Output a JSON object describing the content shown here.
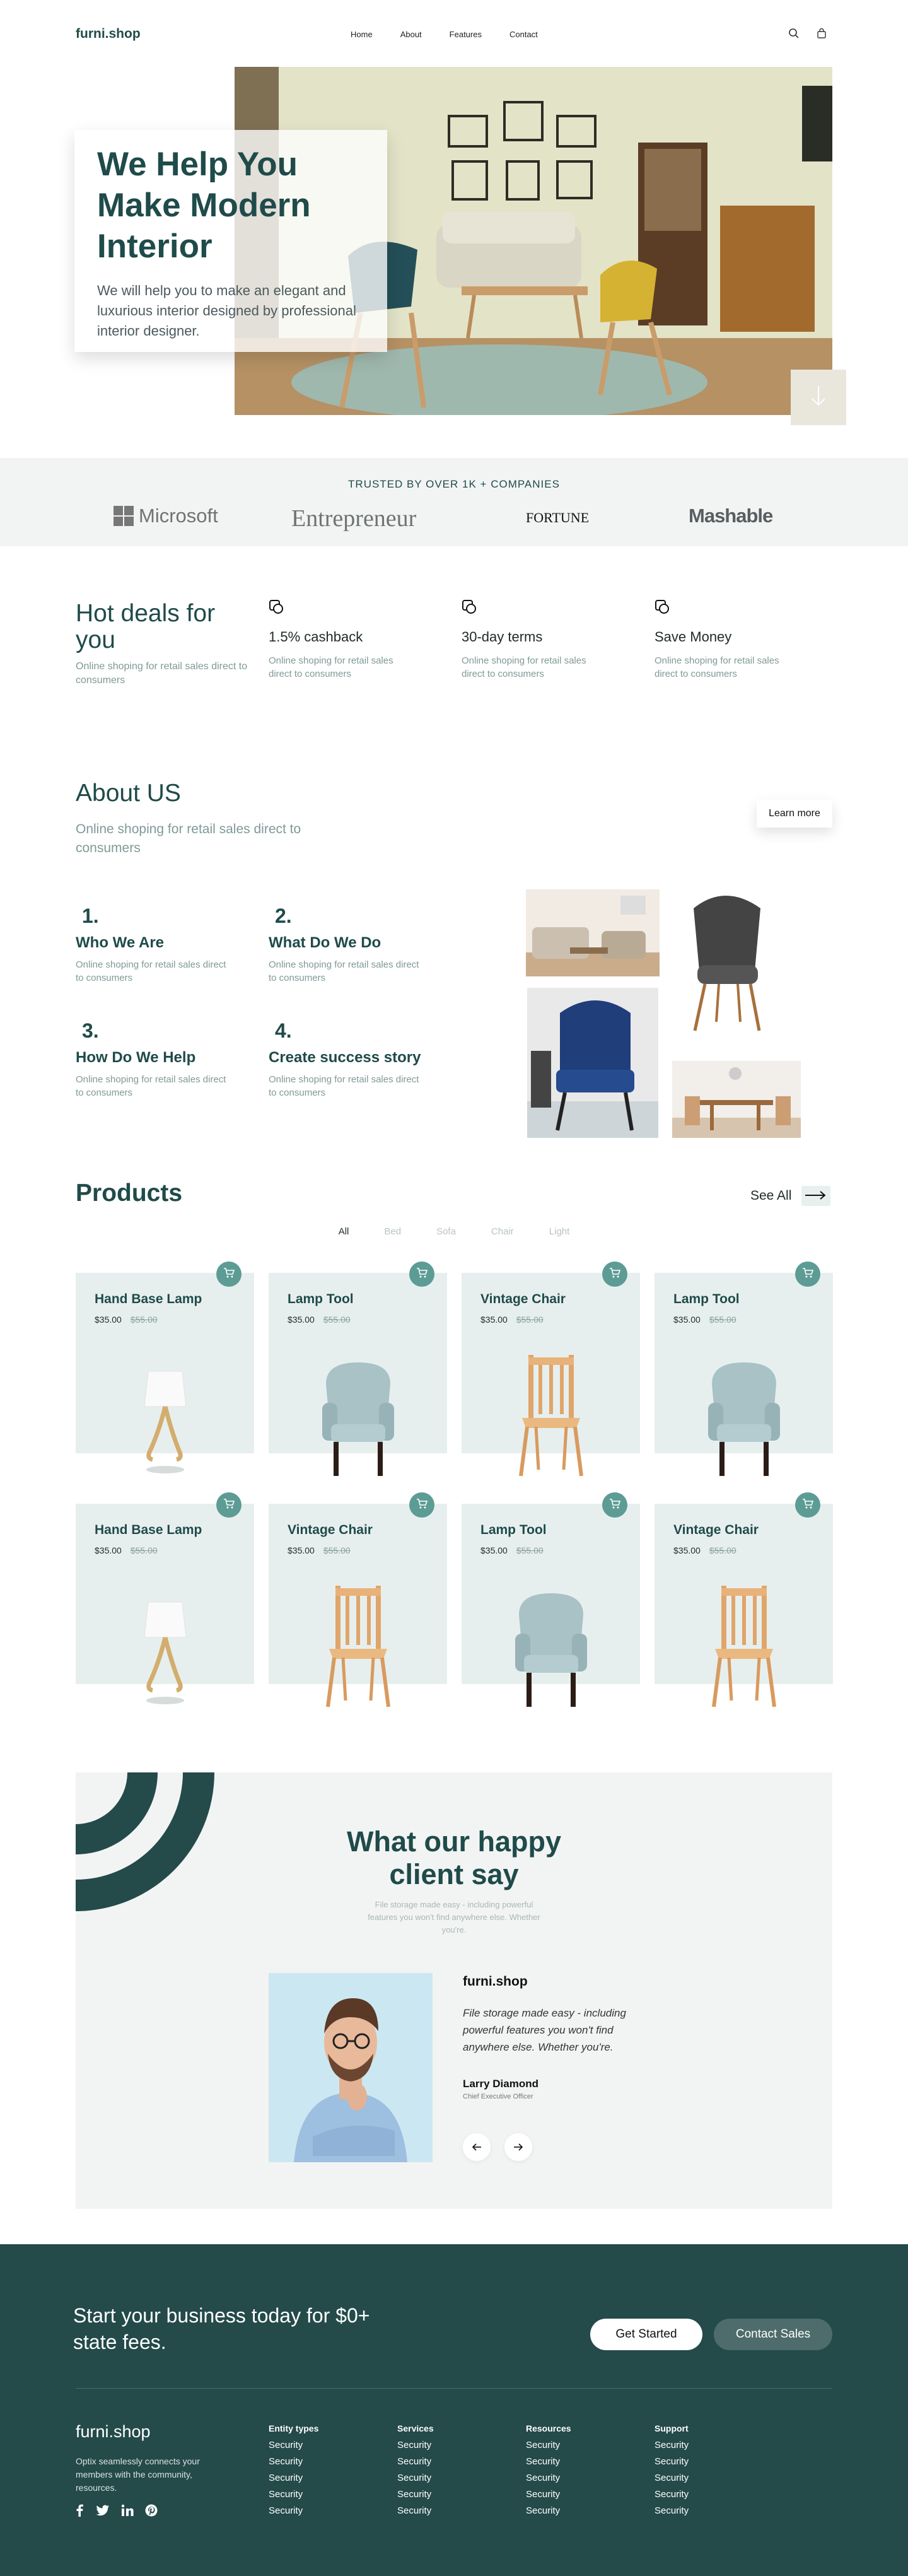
{
  "header": {
    "logo": "furni.shop",
    "nav": [
      "Home",
      "About",
      "Features",
      "Contact"
    ]
  },
  "hero": {
    "title": "We Help You Make Modern Interior",
    "subtitle": "We will help you to make an elegant and luxurious interior designed by professional interior designer."
  },
  "trusted": {
    "title": "TRUSTED BY OVER 1K + COMPANIES",
    "brands": [
      "Microsoft",
      "Entrepreneur",
      "FORTUNE",
      "Mashable"
    ]
  },
  "deals": {
    "title": "Hot deals for you",
    "subtitle": "Online shoping for retail sales direct to consumers",
    "features": [
      {
        "title": "1.5% cashback",
        "text": "Online shoping for retail sales direct to consumers"
      },
      {
        "title": "30-day terms",
        "text": "Online shoping for retail sales direct to consumers"
      },
      {
        "title": "Save Money",
        "text": "Online shoping for retail sales direct to consumers"
      }
    ]
  },
  "about": {
    "title": "About US",
    "subtitle": "Online shoping for retail sales direct to consumers",
    "button": "Learn more",
    "steps": [
      {
        "num": "1.",
        "title": "Who We Are",
        "text": "Online shoping for retail sales direct to consumers"
      },
      {
        "num": "2.",
        "title": "What Do We Do",
        "text": "Online shoping for retail sales direct to consumers"
      },
      {
        "num": "3.",
        "title": "How Do We Help",
        "text": "Online shoping for retail sales direct to consumers"
      },
      {
        "num": "4.",
        "title": "Create success story",
        "text": "Online shoping for retail sales direct to consumers"
      }
    ]
  },
  "products": {
    "title": "Products",
    "see_all": "See All",
    "filters": [
      "All",
      "Bed",
      "Sofa",
      "Chair",
      "Light"
    ],
    "items": [
      {
        "name": "Hand Base Lamp",
        "price": "$35.00",
        "old_price": "$55.00",
        "kind": "lamp"
      },
      {
        "name": "Lamp Tool",
        "price": "$35.00",
        "old_price": "$55.00",
        "kind": "armchair"
      },
      {
        "name": "Vintage Chair",
        "price": "$35.00",
        "old_price": "$55.00",
        "kind": "wood-chair"
      },
      {
        "name": "Lamp Tool",
        "price": "$35.00",
        "old_price": "$55.00",
        "kind": "armchair"
      },
      {
        "name": "Hand Base Lamp",
        "price": "$35.00",
        "old_price": "$55.00",
        "kind": "lamp"
      },
      {
        "name": "Vintage Chair",
        "price": "$35.00",
        "old_price": "$55.00",
        "kind": "wood-chair"
      },
      {
        "name": "Lamp Tool",
        "price": "$35.00",
        "old_price": "$55.00",
        "kind": "armchair"
      },
      {
        "name": "Vintage Chair",
        "price": "$35.00",
        "old_price": "$55.00",
        "kind": "wood-chair"
      }
    ]
  },
  "testimonials": {
    "title": "What our happy client say",
    "subtitle": "File storage made easy - including powerful features you won't find anywhere else. Whether you're.",
    "brand": "furni.shop",
    "quote": "File storage made easy - including powerful features you won't find anywhere else. Whether you're.",
    "name": "Larry Diamond",
    "role": "Chief Executive Officer"
  },
  "footer": {
    "cta": "Start your business today for $0+ state fees.",
    "get_started": "Get Started",
    "contact_sales": "Contact Sales",
    "logo": "furni.shop",
    "description": "Optix seamlessly connects your members with the community, resources.",
    "columns": [
      {
        "title": "Entity types",
        "links": [
          "Security",
          "Security",
          "Security",
          "Security",
          "Security"
        ]
      },
      {
        "title": "Services",
        "links": [
          "Security",
          "Security",
          "Security",
          "Security",
          "Security"
        ]
      },
      {
        "title": "Resources",
        "links": [
          "Security",
          "Security",
          "Security",
          "Security",
          "Security"
        ]
      },
      {
        "title": "Support",
        "links": [
          "Security",
          "Security",
          "Security",
          "Security",
          "Security"
        ]
      }
    ]
  },
  "colors": {
    "brand": "#1f4b4a",
    "accent": "#5c9c94",
    "footer_bg": "#244a4a",
    "card_bg": "#e7efee"
  },
  "icons": {
    "header": [
      "search-icon",
      "bag-icon"
    ],
    "hero": "arrow-down-icon",
    "cart": "cart-icon",
    "social": [
      "facebook-icon",
      "twitter-icon",
      "linkedin-icon",
      "pinterest-icon"
    ]
  }
}
